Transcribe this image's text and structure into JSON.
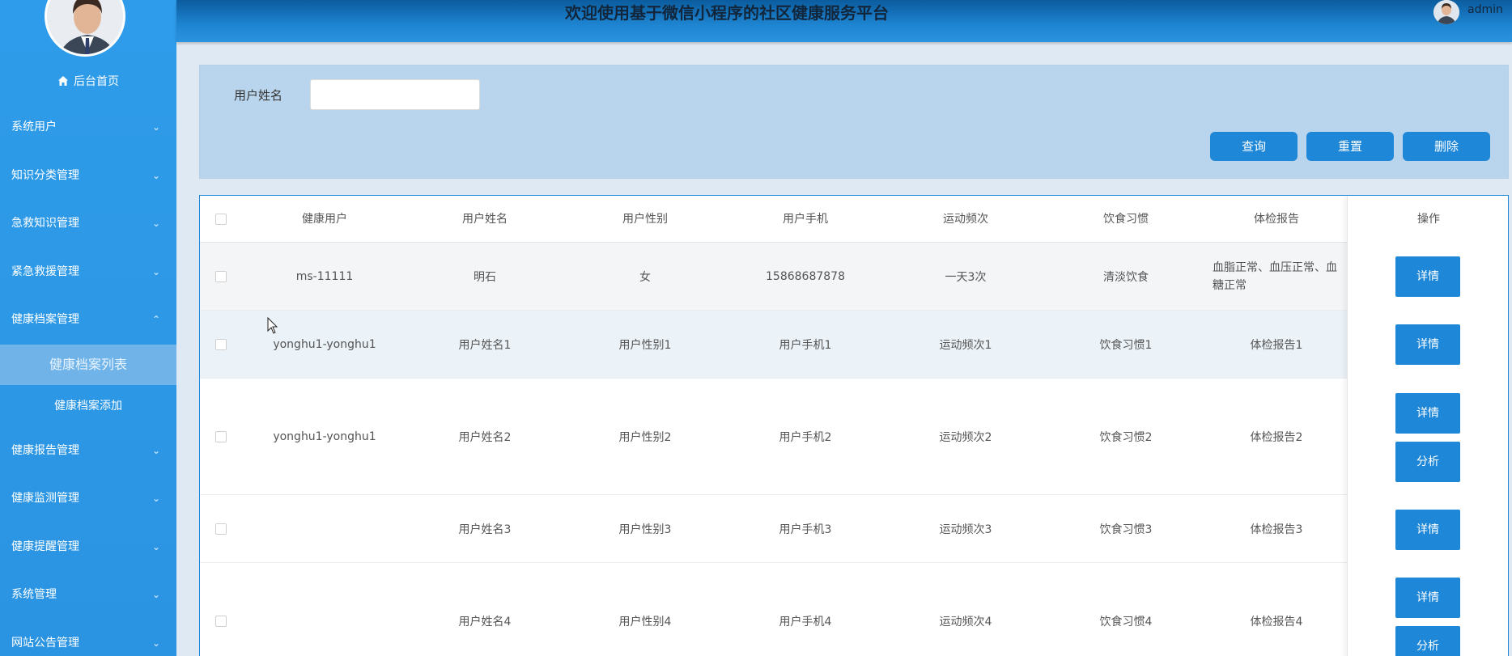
{
  "header": {
    "title": "欢迎使用基于微信小程序的社区健康服务平台",
    "username": "admin"
  },
  "sidebar": {
    "home_label": "后台首页",
    "items": [
      {
        "label": "系统用户"
      },
      {
        "label": "知识分类管理"
      },
      {
        "label": "急救知识管理"
      },
      {
        "label": "紧急救援管理"
      },
      {
        "label": "健康档案管理",
        "expanded": true,
        "children": [
          {
            "label": "健康档案列表",
            "active": true
          },
          {
            "label": "健康档案添加"
          }
        ]
      },
      {
        "label": "健康报告管理"
      },
      {
        "label": "健康监测管理"
      },
      {
        "label": "健康提醒管理"
      },
      {
        "label": "系统管理"
      },
      {
        "label": "网站公告管理"
      }
    ],
    "colors": {
      "bg": "#2e9cea",
      "active_sub": "#6fb3e8"
    }
  },
  "search": {
    "label": "用户姓名",
    "value": "",
    "placeholder": "",
    "buttons": {
      "query": "查询",
      "reset": "重置",
      "delete": "删除"
    }
  },
  "table": {
    "headers": [
      "健康用户",
      "用户姓名",
      "用户性别",
      "用户手机",
      "运动频次",
      "饮食习惯",
      "体检报告",
      "操作"
    ],
    "rows": [
      {
        "user": "ms-11111",
        "name": "明石",
        "gender": "女",
        "phone": "15868687878",
        "exercise": "一天3次",
        "diet": "清淡饮食",
        "report": "血脂正常、血压正常、血糖正常",
        "ops": [
          "详情"
        ]
      },
      {
        "user": "yonghu1-yonghu1",
        "name": "用户姓名1",
        "gender": "用户性别1",
        "phone": "用户手机1",
        "exercise": "运动频次1",
        "diet": "饮食习惯1",
        "report": "体检报告1",
        "ops": [
          "详情"
        ]
      },
      {
        "user": "yonghu1-yonghu1",
        "name": "用户姓名2",
        "gender": "用户性别2",
        "phone": "用户手机2",
        "exercise": "运动频次2",
        "diet": "饮食习惯2",
        "report": "体检报告2",
        "ops": [
          "详情",
          "分析"
        ]
      },
      {
        "user": "",
        "name": "用户姓名3",
        "gender": "用户性别3",
        "phone": "用户手机3",
        "exercise": "运动频次3",
        "diet": "饮食习惯3",
        "report": "体检报告3",
        "ops": [
          "详情"
        ]
      },
      {
        "user": "",
        "name": "用户姓名4",
        "gender": "用户性别4",
        "phone": "用户手机4",
        "exercise": "运动频次4",
        "diet": "饮食习惯4",
        "report": "体检报告4",
        "ops": [
          "详情",
          "分析"
        ]
      }
    ]
  },
  "colors": {
    "accent": "#1e87d8",
    "header_dark": "#0b5c9e"
  }
}
